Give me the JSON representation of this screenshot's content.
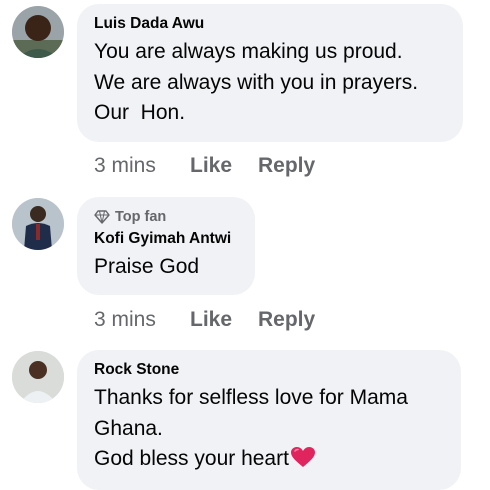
{
  "comments": [
    {
      "author": "Luis Dada Awu",
      "lines": [
        "You are always making us proud.",
        "We are always with you in prayers.",
        "Our  Hon."
      ],
      "time": "3 mins",
      "like": "Like",
      "reply": "Reply"
    },
    {
      "badge": "Top fan",
      "author": "Kofi Gyimah Antwi",
      "lines": [
        "Praise God"
      ],
      "time": "3 mins",
      "like": "Like",
      "reply": "Reply"
    },
    {
      "author": "Rock Stone",
      "lines": [
        "Thanks for selfless love for Mama",
        "Ghana.",
        "God bless your heart"
      ],
      "emoji": "red-heart"
    }
  ],
  "colors": {
    "bubble": "#f0f2f5",
    "secondary_text": "#65676b",
    "primary_text": "#050505",
    "heart": "#e0245e"
  }
}
